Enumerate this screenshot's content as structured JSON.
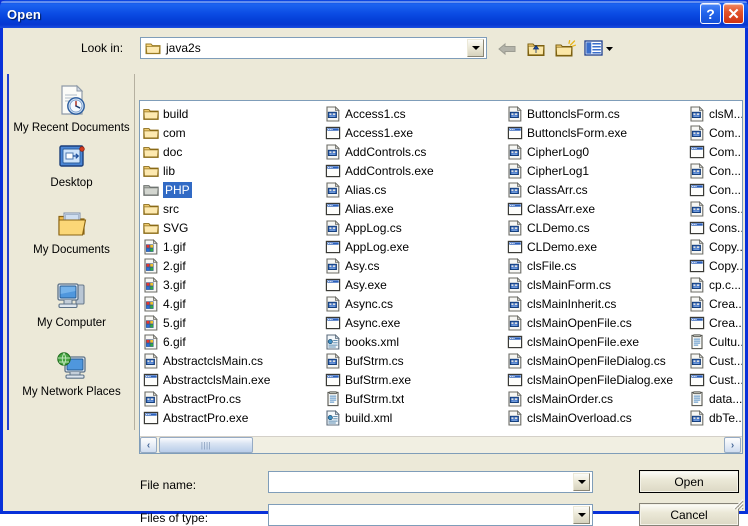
{
  "window": {
    "title": "Open",
    "help_button": "?",
    "close_button": "✕",
    "accent_titlebar": "#0a4ce4",
    "accent_selection": "#316ac5",
    "face_color": "#ece9d8"
  },
  "toolbar": {
    "lookin_label": "Look in:",
    "lookin_value": "java2s",
    "buttons": [
      {
        "name": "back-icon",
        "tooltip": "Back",
        "disabled": true
      },
      {
        "name": "up-one-level-icon",
        "tooltip": "Up One Level",
        "disabled": false
      },
      {
        "name": "new-folder-icon",
        "tooltip": "Create New Folder",
        "disabled": false
      },
      {
        "name": "views-icon",
        "tooltip": "Views",
        "disabled": false
      }
    ]
  },
  "places_bar": {
    "items": [
      {
        "label": "My Recent Documents",
        "icon": "recent-documents-icon"
      },
      {
        "label": "Desktop",
        "icon": "desktop-icon"
      },
      {
        "label": "My Documents",
        "icon": "my-documents-icon"
      },
      {
        "label": "My Computer",
        "icon": "my-computer-icon"
      },
      {
        "label": "My Network Places",
        "icon": "network-places-icon"
      }
    ]
  },
  "file_list": {
    "selected": "PHP",
    "items": [
      {
        "name": "build",
        "type": "folder",
        "selected": false
      },
      {
        "name": "com",
        "type": "folder",
        "selected": false
      },
      {
        "name": "doc",
        "type": "folder",
        "selected": false
      },
      {
        "name": "lib",
        "type": "folder",
        "selected": false
      },
      {
        "name": "PHP",
        "type": "folder",
        "selected": true
      },
      {
        "name": "src",
        "type": "folder",
        "selected": false
      },
      {
        "name": "SVG",
        "type": "folder",
        "selected": false
      },
      {
        "name": "1.gif",
        "type": "image",
        "selected": false
      },
      {
        "name": "2.gif",
        "type": "image",
        "selected": false
      },
      {
        "name": "3.gif",
        "type": "image",
        "selected": false
      },
      {
        "name": "4.gif",
        "type": "image",
        "selected": false
      },
      {
        "name": "5.gif",
        "type": "image",
        "selected": false
      },
      {
        "name": "6.gif",
        "type": "image",
        "selected": false
      },
      {
        "name": "AbstractclsMain.cs",
        "type": "cs",
        "selected": false
      },
      {
        "name": "AbstractclsMain.exe",
        "type": "exe",
        "selected": false
      },
      {
        "name": "AbstractPro.cs",
        "type": "cs",
        "selected": false
      },
      {
        "name": "AbstractPro.exe",
        "type": "exe",
        "selected": false
      },
      {
        "name": "Access1.cs",
        "type": "cs",
        "selected": false
      },
      {
        "name": "Access1.exe",
        "type": "exe",
        "selected": false
      },
      {
        "name": "AddControls.cs",
        "type": "cs",
        "selected": false
      },
      {
        "name": "AddControls.exe",
        "type": "exe",
        "selected": false
      },
      {
        "name": "Alias.cs",
        "type": "cs",
        "selected": false
      },
      {
        "name": "Alias.exe",
        "type": "exe",
        "selected": false
      },
      {
        "name": "AppLog.cs",
        "type": "cs",
        "selected": false
      },
      {
        "name": "AppLog.exe",
        "type": "exe",
        "selected": false
      },
      {
        "name": "Asy.cs",
        "type": "cs",
        "selected": false
      },
      {
        "name": "Asy.exe",
        "type": "exe",
        "selected": false
      },
      {
        "name": "Async.cs",
        "type": "cs",
        "selected": false
      },
      {
        "name": "Async.exe",
        "type": "exe",
        "selected": false
      },
      {
        "name": "books.xml",
        "type": "xml",
        "selected": false
      },
      {
        "name": "BufStrm.cs",
        "type": "cs",
        "selected": false
      },
      {
        "name": "BufStrm.exe",
        "type": "exe",
        "selected": false
      },
      {
        "name": "BufStrm.txt",
        "type": "txt",
        "selected": false
      },
      {
        "name": "build.xml",
        "type": "xml",
        "selected": false
      },
      {
        "name": "ButtonclsForm.cs",
        "type": "cs",
        "selected": false
      },
      {
        "name": "ButtonclsForm.exe",
        "type": "exe",
        "selected": false
      },
      {
        "name": "CipherLog0",
        "type": "cs",
        "selected": false
      },
      {
        "name": "CipherLog1",
        "type": "cs",
        "selected": false
      },
      {
        "name": "ClassArr.cs",
        "type": "cs",
        "selected": false
      },
      {
        "name": "ClassArr.exe",
        "type": "exe",
        "selected": false
      },
      {
        "name": "CLDemo.cs",
        "type": "cs",
        "selected": false
      },
      {
        "name": "CLDemo.exe",
        "type": "exe",
        "selected": false
      },
      {
        "name": "clsFile.cs",
        "type": "cs",
        "selected": false
      },
      {
        "name": "clsMainForm.cs",
        "type": "cs",
        "selected": false
      },
      {
        "name": "clsMainInherit.cs",
        "type": "cs",
        "selected": false
      },
      {
        "name": "clsMainOpenFile.cs",
        "type": "cs",
        "selected": false
      },
      {
        "name": "clsMainOpenFile.exe",
        "type": "exe",
        "selected": false
      },
      {
        "name": "clsMainOpenFileDialog.cs",
        "type": "cs",
        "selected": false
      },
      {
        "name": "clsMainOpenFileDialog.exe",
        "type": "exe",
        "selected": false
      },
      {
        "name": "clsMainOrder.cs",
        "type": "cs",
        "selected": false
      },
      {
        "name": "clsMainOverload.cs",
        "type": "cs",
        "selected": false
      },
      {
        "name": "clsM...",
        "type": "cs",
        "selected": false
      },
      {
        "name": "Com...",
        "type": "cs",
        "selected": false
      },
      {
        "name": "Com...",
        "type": "exe",
        "selected": false
      },
      {
        "name": "Con...",
        "type": "cs",
        "selected": false
      },
      {
        "name": "Con...",
        "type": "exe",
        "selected": false
      },
      {
        "name": "Cons...",
        "type": "cs",
        "selected": false
      },
      {
        "name": "Cons...",
        "type": "exe",
        "selected": false
      },
      {
        "name": "Copy...",
        "type": "cs",
        "selected": false
      },
      {
        "name": "Copy...",
        "type": "exe",
        "selected": false
      },
      {
        "name": "cp.c...",
        "type": "cs",
        "selected": false
      },
      {
        "name": "Crea...",
        "type": "cs",
        "selected": false
      },
      {
        "name": "Crea...",
        "type": "exe",
        "selected": false
      },
      {
        "name": "Cultu...",
        "type": "txt",
        "selected": false
      },
      {
        "name": "Cust...",
        "type": "cs",
        "selected": false
      },
      {
        "name": "Cust...",
        "type": "exe",
        "selected": false
      },
      {
        "name": "data...",
        "type": "txt",
        "selected": false
      },
      {
        "name": "dbTe...",
        "type": "cs",
        "selected": false
      }
    ]
  },
  "scrollbar": {
    "left_arrow": "‹",
    "right_arrow": "›",
    "thumb_grip": "||||"
  },
  "form": {
    "filename_label": "File name:",
    "filename_value": "",
    "filename_placeholder": "",
    "filetype_label": "Files of type:",
    "filetype_value": "",
    "filetype_placeholder": "",
    "open_label": "Open",
    "cancel_label": "Cancel"
  }
}
